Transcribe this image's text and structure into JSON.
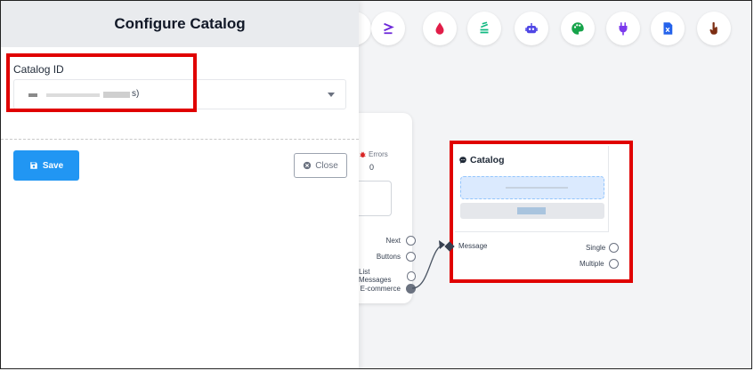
{
  "panel": {
    "title": "Configure Catalog",
    "field_label": "Catalog ID",
    "select_value_visible": "s)",
    "save_label": "Save",
    "close_label": "Close"
  },
  "toolbar": {
    "icons": [
      {
        "name": "greater-equal-icon",
        "glyph": "≥",
        "color": "#6d28d9"
      },
      {
        "name": "drop-icon",
        "color": "#e11d48"
      },
      {
        "name": "stack-icon",
        "color": "#10b981"
      },
      {
        "name": "robot-icon",
        "color": "#4f46e5"
      },
      {
        "name": "palette-icon",
        "color": "#16a34a"
      },
      {
        "name": "plug-icon",
        "color": "#7c3aed"
      },
      {
        "name": "excel-file-icon",
        "color": "#2563eb"
      },
      {
        "name": "pointer-hand-icon",
        "color": "#7c2d12"
      }
    ]
  },
  "partial_node": {
    "cut_text": "rs",
    "errors_label": "Errors",
    "errors_value": "0",
    "outlets": [
      "Next",
      "Buttons",
      "List Messages",
      "E-commerce"
    ]
  },
  "catalog_node": {
    "title": "Catalog",
    "input_label": "Message",
    "outputs": [
      "Single",
      "Multiple"
    ]
  },
  "colors": {
    "highlight": "#e00000",
    "primary": "#2196f3",
    "canvas_bg": "#f3f4f6",
    "header_bg": "#e9ebee"
  }
}
